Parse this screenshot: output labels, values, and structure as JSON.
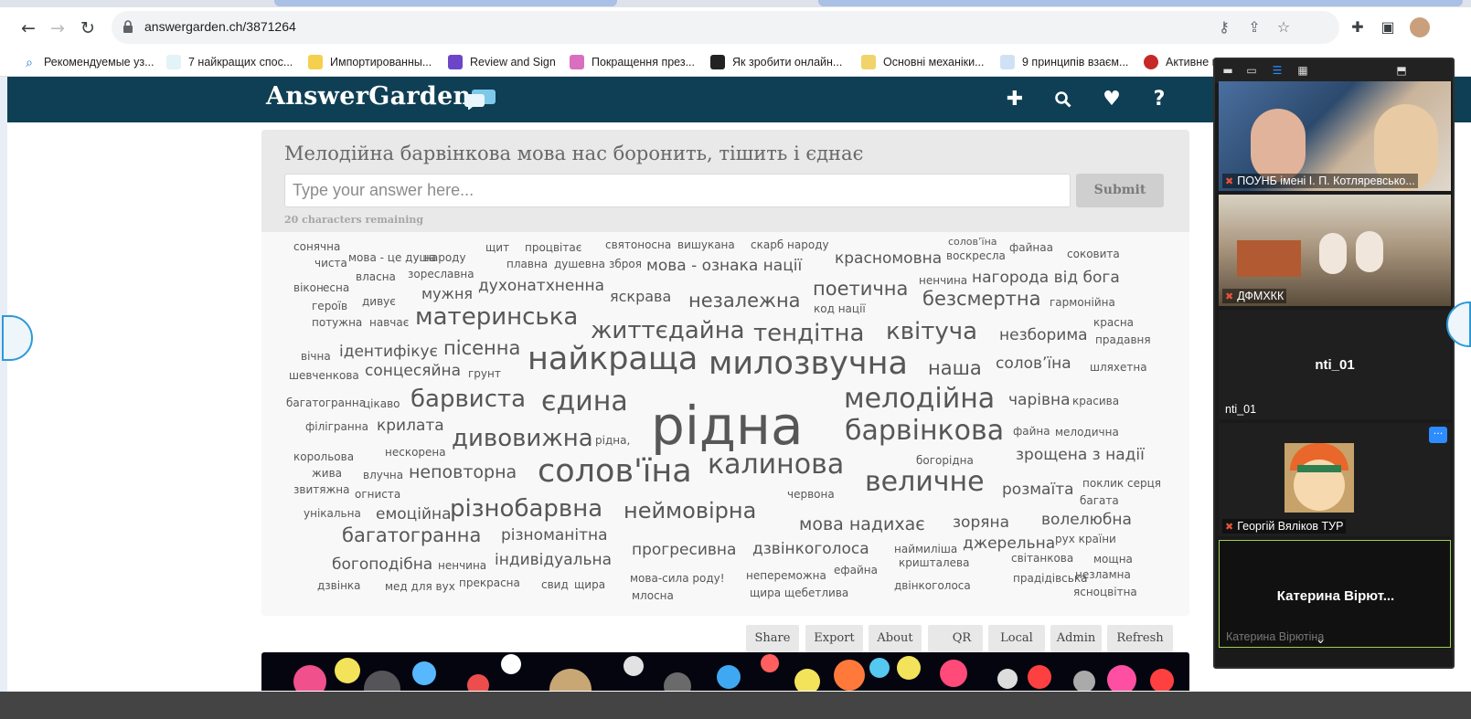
{
  "browser": {
    "url": "answergarden.ch/3871264",
    "bookmarks": [
      "Рекомендуемые уз...",
      "7 найкращих спос...",
      "Импортированны...",
      "Review and Sign",
      "Покращення през...",
      "Як зробити онлайн...",
      "Основні механіки...",
      "9 принципів взаєм...",
      "Активне навча..."
    ]
  },
  "header": {
    "logo": "AnswerGarden",
    "icons": [
      "plus-icon",
      "search-icon",
      "heart-icon",
      "help-icon"
    ]
  },
  "question": {
    "text": "Мелодійна барвінкова мова нас боронить, тішить і єднає",
    "placeholder": "Type your answer here...",
    "submit_label": "Submit",
    "remaining": "20 characters remaining"
  },
  "cloud_words": [
    "сонячна",
    "чиста",
    "мова - це душа",
    "народу",
    "щит",
    "процвітає",
    "святоносна",
    "вишукана",
    "скарб народу",
    "солов’їна",
    "соковита",
    "вікон",
    "есна",
    "власна",
    "зореславна",
    "плавна",
    "душевна",
    "зброя",
    "мова - ознака нації",
    "красномовна",
    "воскресла",
    "файнаа",
    "героїв",
    "мужня",
    "духонатхненна",
    "нагорода від бога",
    "ненчина",
    "потужна",
    "дивує",
    "яскрава",
    "незалежна",
    "поетична",
    "безсмертна",
    "гармонійна",
    "навчає",
    "материнська",
    "код нації",
    "життєдайна",
    "тендітна",
    "квітуча",
    "незборима",
    "красна",
    "прадавня",
    "вічна",
    "ідентифікує",
    "пісенна",
    "солов’їна",
    "шевченкова",
    "сонцесяйна",
    "грунт",
    "найкраща",
    "милозвучна",
    "наша",
    "шляхетна",
    "багатогранна",
    "цікаво",
    "барвиста",
    "єдина",
    "мелодійна",
    "чарівна",
    "красива",
    "рідна",
    "філігранна",
    "крилата",
    "барвінкова",
    "файна",
    "мелодична",
    "корольова",
    "нескорена",
    "дивовижна",
    "рідна,",
    "богорідна",
    "зрощена з надії",
    "жива",
    "влучна",
    "неповторна",
    "солов'їна",
    "калинова",
    "величне",
    "поклик серця",
    "звитяжна",
    "огниста",
    "червона",
    "розмаїта",
    "багата",
    "унікальна",
    "емоційна",
    "різнобарвна",
    "неймовірна",
    "мова надихає",
    "зоряна",
    "волелюбна",
    "багатогранна",
    "різноманітна",
    "прогресивна",
    "дзвінкоголоса",
    "наймиліша",
    "джерельна",
    "рух країни",
    "богоподібна",
    "ненчина",
    "індивідуальна",
    "кришталева",
    "світанкова",
    "мощна",
    "дзвінка",
    "мед для вух",
    "прекрасна",
    "свид",
    "щира",
    "мова-сила роду!",
    "непереможна",
    "ефайна",
    "двінкоголоса",
    "прадідівська",
    "незламна",
    "млосна",
    "щира щебетлива",
    "ясноцвітна"
  ],
  "actions": [
    "Share",
    "Export",
    "About",
    "QR",
    "Local",
    "Admin",
    "Refresh"
  ],
  "zoom": {
    "participants": [
      "ПОУНБ імені І. П. Котляревсько...",
      "ДФМХКК",
      "nti_01",
      "Георгій Вяліков ТУР",
      "Катерина  Вірют...",
      "Катерина Вірютіна"
    ],
    "tile3_big": "nti_01"
  }
}
